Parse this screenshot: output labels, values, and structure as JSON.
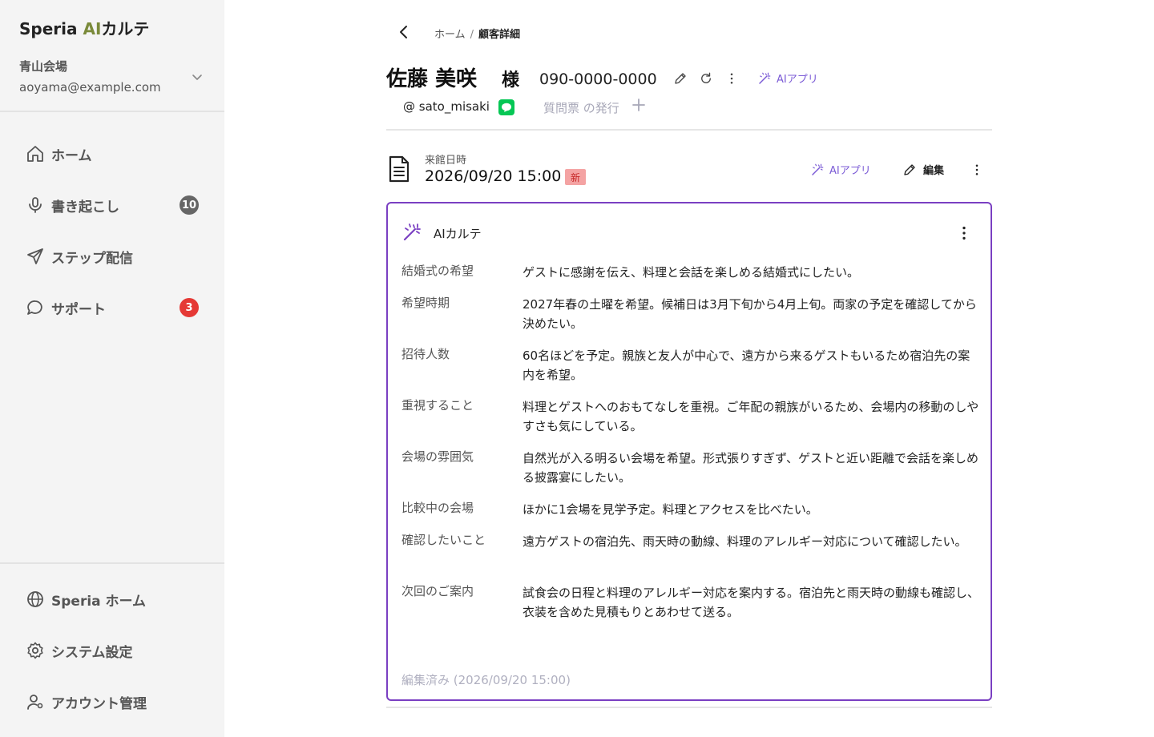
{
  "sidebar": {
    "brand_prefix": "Speria ",
    "brand_ai": "AI",
    "brand_suffix": "カルテ",
    "venue": "青山会場",
    "email": "aoyama@example.com",
    "nav": [
      {
        "label": "ホーム",
        "icon": "home-icon"
      },
      {
        "label": "書き起こし",
        "icon": "microphone-icon",
        "badge": "10"
      },
      {
        "label": "ステップ配信",
        "icon": "send-icon"
      },
      {
        "label": "サポート",
        "icon": "chat-bubble-icon",
        "badge": "3"
      }
    ],
    "bottom_nav": [
      {
        "label": "Speria ホーム",
        "icon": "globe-icon"
      },
      {
        "label": "システム設定",
        "icon": "gear-icon"
      },
      {
        "label": "アカウント管理",
        "icon": "user-settings-icon"
      }
    ]
  },
  "breadcrumb": {
    "home": "ホーム",
    "separator": "/",
    "current": "顧客詳細"
  },
  "customer": {
    "name": "佐藤 美咲",
    "suffix": "様",
    "phone": "090-0000-0000",
    "ai_app_label": "AIアプリ",
    "line_id": "@ sato_misaki",
    "issue_questionnaire": "質問票 の発行"
  },
  "visit": {
    "label": "来館日時",
    "datetime": "2026/09/20 15:00",
    "new_badge": "新",
    "ai_app_label": "AIアプリ",
    "edit_label": "編集"
  },
  "karte": {
    "title": "AIカルテ",
    "fields": [
      {
        "label": "結婚式の希望",
        "value": "ゲストに感謝を伝え、料理と会話を楽しめる結婚式にしたい。"
      },
      {
        "label": "希望時期",
        "value": "2027年春の土曜を希望。候補日は3月下旬から4月上旬。両家の予定を確認してから決めたい。"
      },
      {
        "label": "招待人数",
        "value": "60名ほどを予定。親族と友人が中心で、遠方から来るゲストもいるため宿泊先の案内を希望。"
      },
      {
        "label": "重視すること",
        "value": "料理とゲストへのおもてなしを重視。ご年配の親族がいるため、会場内の移動のしやすさも気にしている。"
      },
      {
        "label": "会場の雰囲気",
        "value": "自然光が入る明るい会場を希望。形式張りすぎず、ゲストと近い距離で会話を楽しめる披露宴にしたい。"
      },
      {
        "label": "比較中の会場",
        "value": "ほかに1会場を見学予定。料理とアクセスを比べたい。"
      },
      {
        "label": "確認したいこと",
        "value": "遠方ゲストの宿泊先、雨天時の動線、料理のアレルギー対応について確認したい。"
      },
      {
        "label": "次回のご案内",
        "value": "試食会の日程と料理のアレルギー対応を案内する。宿泊先と雨天時の動線も確認し、衣装を含めた見積もりとあわせて送る。"
      }
    ],
    "edited_note": "編集済み (2026/09/20 15:00)"
  },
  "colors": {
    "accent_purple": "#7a3fc2",
    "ai_link": "#7b5bd6",
    "badge_red": "#e53935",
    "line_green": "#06c755"
  }
}
